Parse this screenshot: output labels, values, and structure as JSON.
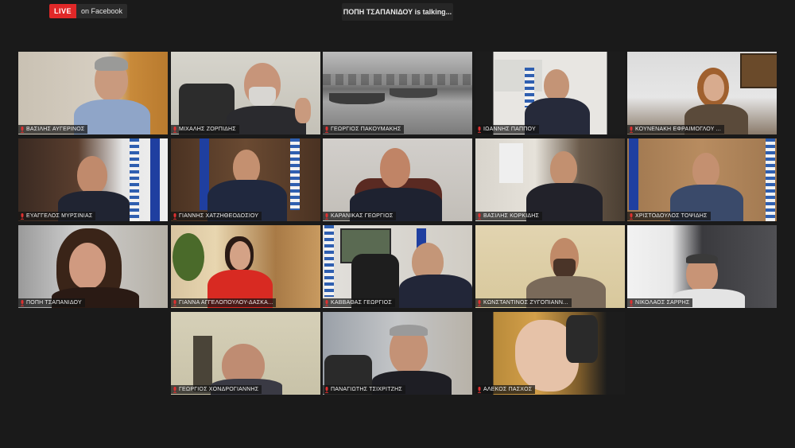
{
  "live": {
    "badge": "LIVE",
    "platform": "on Facebook"
  },
  "talking": "ΠΟΠΗ ΤΣΑΠΑΝΙΔΟΥ is talking...",
  "participants": [
    {
      "name": "ΒΑΣΙΛΗΣ ΑΥΓΕΡΙΝΟΣ"
    },
    {
      "name": "ΜΙΧΑΛΗΣ ΖΟΡΠΙΔΗΣ"
    },
    {
      "name": "ΓΕΩΡΓΙΟΣ ΠΑΚΟΥΜΑΚΗΣ"
    },
    {
      "name": "ΙΩΑΝΝΗΣ ΠΑΠΠΟΥ"
    },
    {
      "name": "ΚΟΥΝΕΝΑΚΗ ΕΦΡΑΙΜΟΓΛΟΥ ..."
    },
    {
      "name": "ΕΥΑΓΓΕΛΟΣ ΜΥΡΣΙΝΙΑΣ"
    },
    {
      "name": "ΓΙΑΝΝΗΣ ΧΑΤΖΗΘΕΟΔΟΣΙΟΥ"
    },
    {
      "name": "ΚΑΡΑΝΙΚΑΣ ΓΕΩΡΓΙΟΣ"
    },
    {
      "name": "ΒΑΣΙΛΗΣ ΚΟΡΚΙΔΗΣ"
    },
    {
      "name": "ΧΡΙΣΤΟΔΟΥΛΟΣ ΤΟΨΙΔΗΣ"
    },
    {
      "name": "ΠΟΠΗ ΤΣΑΠΑΝΙΔΟΥ"
    },
    {
      "name": "ΓΙΑΝΝΑ ΑΓΓΕΛΟΠΟΥΛΟΥ-ΔΑΣΚΑ..."
    },
    {
      "name": "ΚΑΒΒΑΘΑΣ ΓΕΩΡΓΙΟΣ"
    },
    {
      "name": "ΚΩΝΣΤΑΝΤΙΝΟΣ ΖΥΓΟΠΙΑΝΝ..."
    },
    {
      "name": "ΝΙΚΟΛΑΟΣ ΣΑΡΡΗΣ"
    },
    {
      "name": "ΓΕΩΡΓΙΟΣ ΧΟΝΔΡΟΓΙΑΝΝΗΣ"
    },
    {
      "name": "ΠΑΝΑΓΙΩΤΗΣ ΤΣΙΧΡΙΤΖΗΣ"
    },
    {
      "name": "ΑΛΕΚΟΣ ΠΑΣΧΟΣ"
    }
  ],
  "colors": {
    "live": "#e02828",
    "active_border": "#c9d64a",
    "muted_mic": "#e03030"
  },
  "icons": {
    "mic": "microphone-muted-icon"
  }
}
